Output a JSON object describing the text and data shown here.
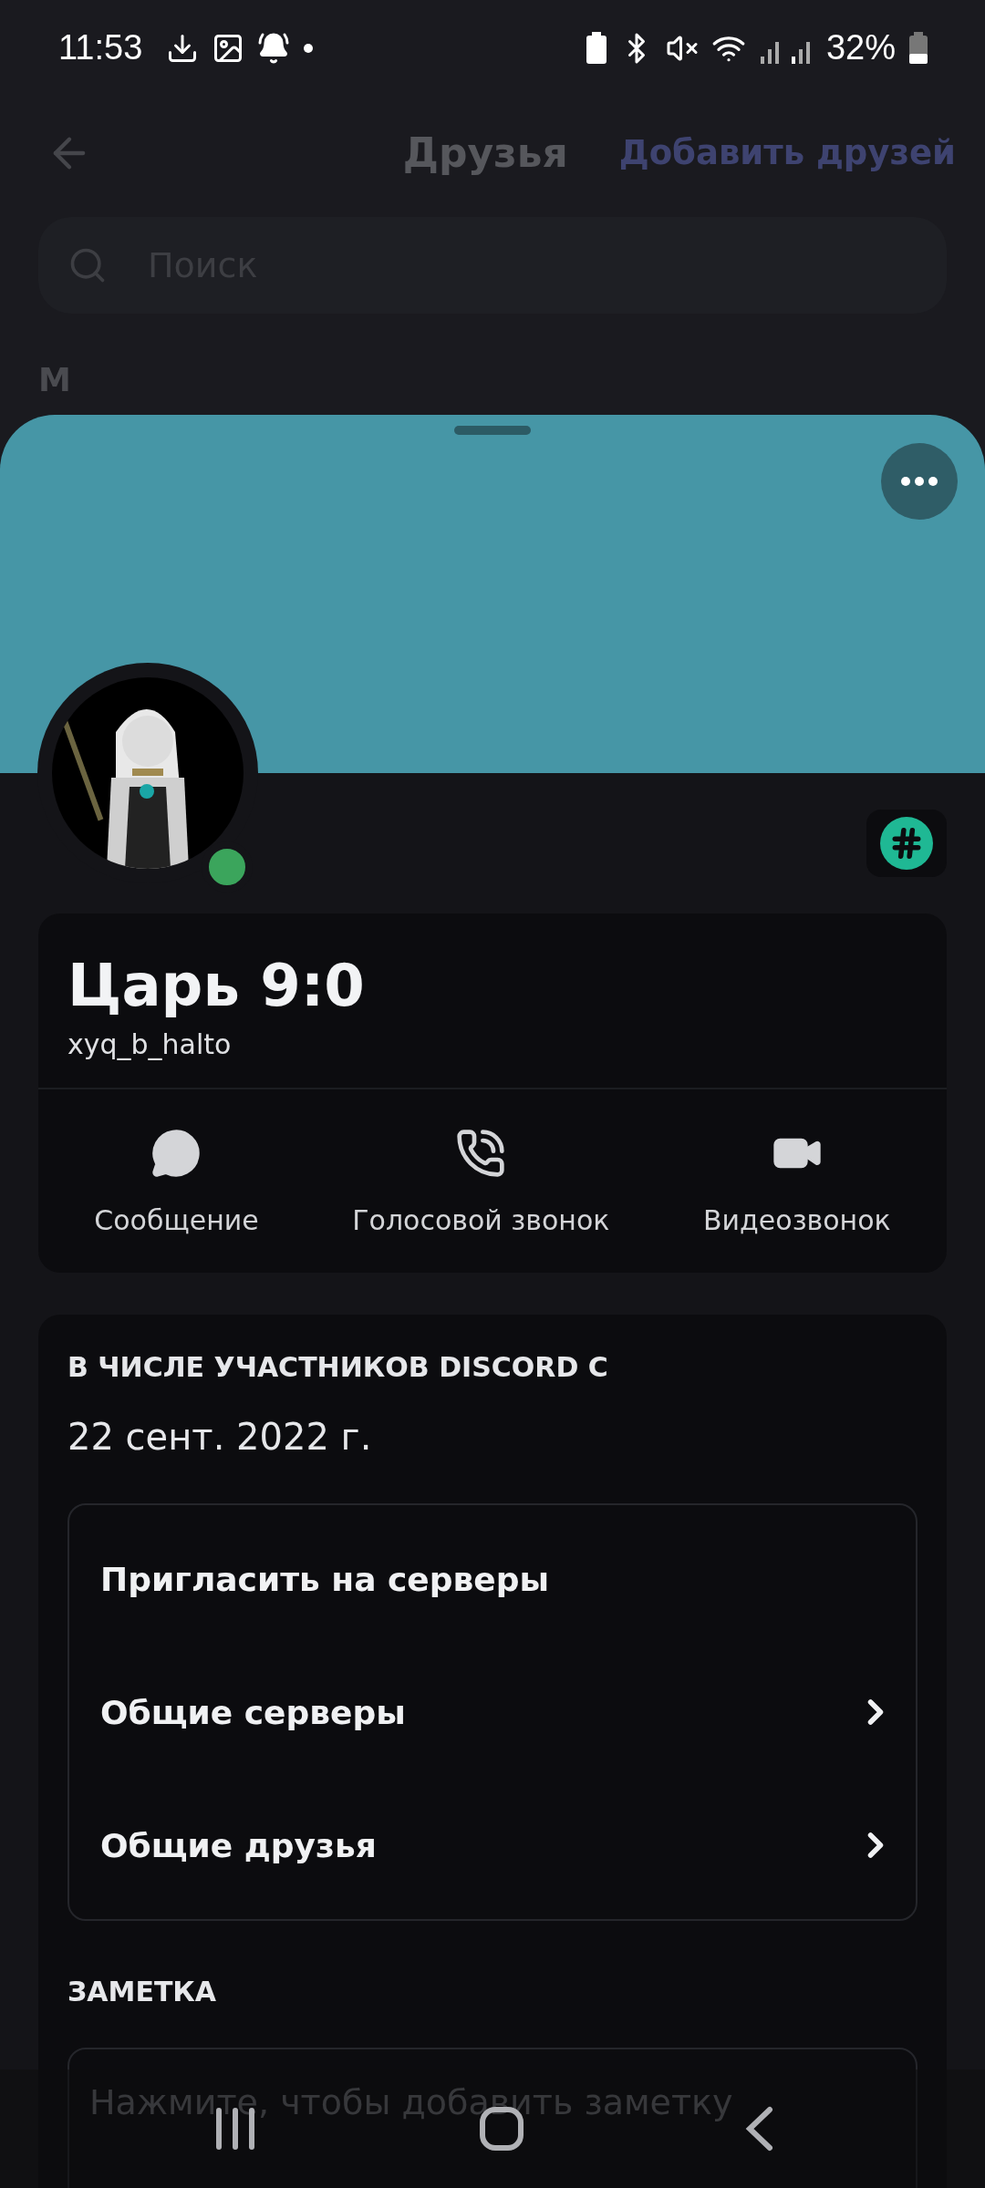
{
  "status_bar": {
    "time": "11:53",
    "battery": "32%"
  },
  "header": {
    "title": "Друзья",
    "action": "Добавить друзей"
  },
  "search": {
    "placeholder": "Поиск"
  },
  "section_letter": "М",
  "profile": {
    "display_name": "Царь 9:0",
    "username": "xyq_b_halto",
    "online": true
  },
  "actions": [
    {
      "kind": "message",
      "label": "Сообщение"
    },
    {
      "kind": "call",
      "label": "Голосовой звонок"
    },
    {
      "kind": "video",
      "label": "Видеозвонок"
    }
  ],
  "member_since": {
    "label": "В ЧИСЛЕ УЧАСТНИКОВ DISCORD С",
    "date": "22 сент. 2022 г."
  },
  "menu": [
    {
      "label": "Пригласить на серверы",
      "has_chevron": false
    },
    {
      "label": "Общие серверы",
      "has_chevron": true
    },
    {
      "label": "Общие друзья",
      "has_chevron": true
    }
  ],
  "note": {
    "label": "ЗАМЕТКА",
    "placeholder": "Нажмите, чтобы добавить заметку"
  }
}
